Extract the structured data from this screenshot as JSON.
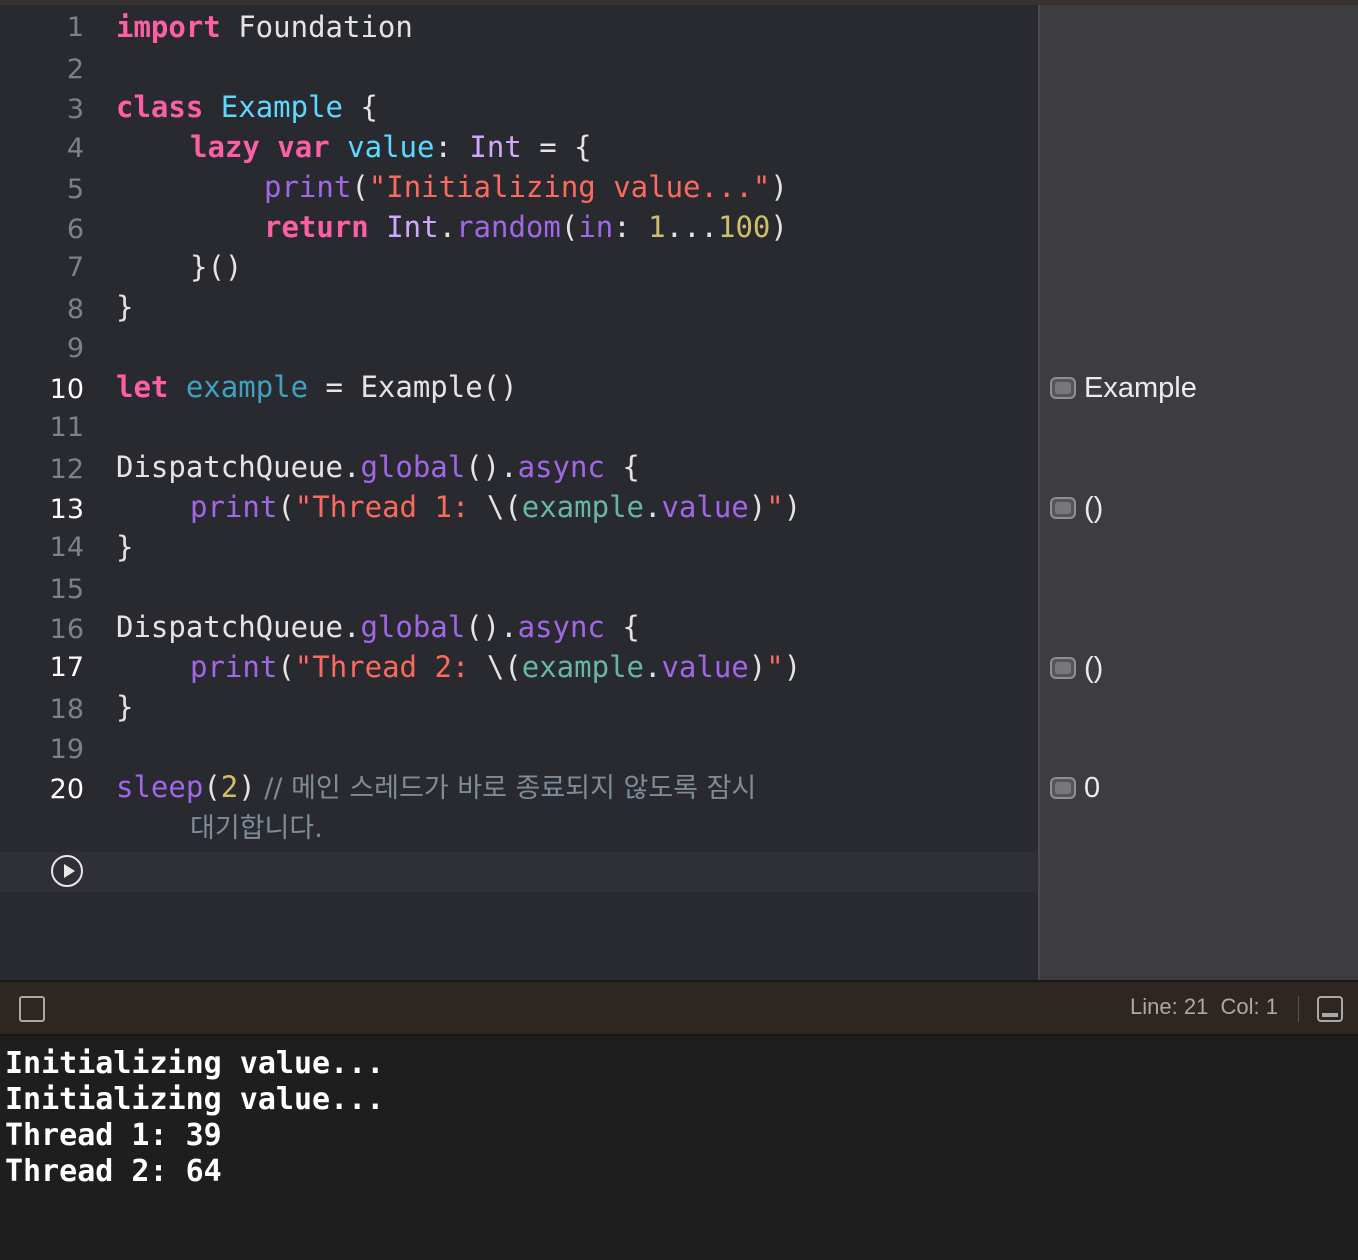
{
  "editor": {
    "line_numbers": [
      "1",
      "2",
      "3",
      "4",
      "5",
      "6",
      "7",
      "8",
      "9",
      "10",
      "11",
      "12",
      "13",
      "14",
      "15",
      "16",
      "17",
      "18",
      "19",
      "20"
    ],
    "tokens": {
      "l1_import": "import",
      "l1_foundation": " Foundation",
      "l3_class": "class",
      "l3_name": " Example",
      "l3_brace": " {",
      "l4_lazy": "lazy",
      "l4_var": " var",
      "l4_value": " value",
      "l4_colon": ": ",
      "l4_int": "Int",
      "l4_eq": " = {",
      "l5_print": "print",
      "l5_paren": "(",
      "l5_str": "\"Initializing value...\"",
      "l5_close": ")",
      "l6_return": "return",
      "l6_int": " Int",
      "l6_dot": ".",
      "l6_random": "random",
      "l6_paren": "(",
      "l6_in": "in",
      "l6_colon": ": ",
      "l6_one": "1",
      "l6_range": "...",
      "l6_hundred": "100",
      "l6_close": ")",
      "l7": "}()",
      "l8": "}",
      "l10_let": "let",
      "l10_example": " example",
      "l10_rest": " = Example()",
      "l12_dq": "DispatchQueue.",
      "l12_global": "global",
      "l12_mid": "().",
      "l12_async": "async",
      "l12_brace": " {",
      "l13_print": "print",
      "l13_paren": "(",
      "l13_str": "\"Thread 1: ",
      "l13_interp": "\\(",
      "l13_example": "example",
      "l13_dot": ".",
      "l13_value": "value",
      "l13_close1": ")",
      "l13_strend": "\"",
      "l13_close2": ")",
      "l14": "}",
      "l16_dq": "DispatchQueue.",
      "l16_global": "global",
      "l16_mid": "().",
      "l16_async": "async",
      "l16_brace": " {",
      "l17_print": "print",
      "l17_paren": "(",
      "l17_str": "\"Thread 2: ",
      "l17_interp": "\\(",
      "l17_example": "example",
      "l17_dot": ".",
      "l17_value": "value",
      "l17_close1": ")",
      "l17_strend": "\"",
      "l17_close2": ")",
      "l18": "}",
      "l20_sleep": "sleep",
      "l20_paren": "(",
      "l20_num": "2",
      "l20_close": ")",
      "l20_comment": " // 메인 스레드가 바로 종료되지 않도록 잠시",
      "l20_comment_wrap": "대기합니다."
    }
  },
  "results": [
    {
      "line": "10",
      "text": "Example"
    },
    {
      "line": "13",
      "text": "()"
    },
    {
      "line": "17",
      "text": "()"
    },
    {
      "line": "20",
      "text": "0"
    }
  ],
  "statusbar": {
    "cursor": "Line: 21  Col: 1"
  },
  "console": {
    "lines": [
      "Initializing value...",
      "Initializing value...",
      "Thread 1: 39",
      "Thread 2: 64"
    ]
  },
  "icons": {
    "run": "play-circle-icon",
    "result": "quick-look-icon",
    "console_toggle": "square-checkbox-icon",
    "panel_toggle": "bottom-panel-icon"
  }
}
